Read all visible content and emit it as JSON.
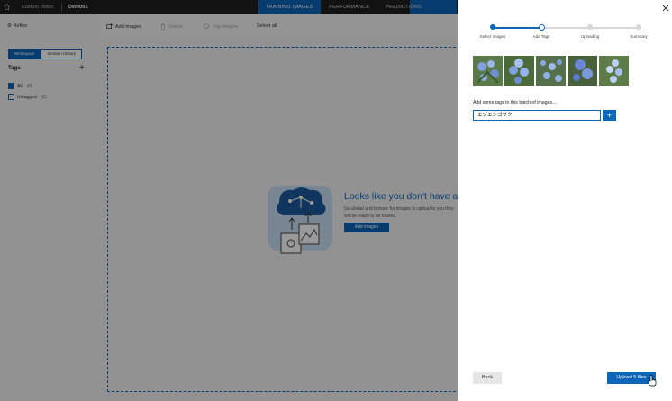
{
  "topbar": {
    "app_name": "Custom Vision",
    "project_name": "Demo01",
    "tabs": [
      {
        "label": "TRAINING IMAGES",
        "active": true
      },
      {
        "label": "PERFORMANCE",
        "active": false
      },
      {
        "label": "PREDICTIONS",
        "active": false
      }
    ]
  },
  "sidebar": {
    "refine_label": "Refine",
    "view_toggle": {
      "workspace": "Workspace",
      "iteration_history": "Iteration History"
    },
    "tags_title": "Tags",
    "tags": [
      {
        "label": "All",
        "count": "(0)",
        "checked": true
      },
      {
        "label": "Untagged",
        "count": "(0)",
        "checked": false
      }
    ]
  },
  "toolbar": {
    "add_images": "Add images",
    "delete": "Delete",
    "tag_images": "Tag images",
    "select_all": "Select all"
  },
  "empty_state": {
    "heading": "Looks like you don't have any",
    "description": "Go ahead and browse for images to upload to you they will be ready to be trained.",
    "button": "Add images"
  },
  "upload_panel": {
    "steps": [
      {
        "label": "Select Images",
        "state": "done"
      },
      {
        "label": "Add Tags",
        "state": "current"
      },
      {
        "label": "Uploading",
        "state": "pending"
      },
      {
        "label": "Summary",
        "state": "pending"
      }
    ],
    "batch_tag_label": "Add some tags to this batch of images...",
    "tag_input_value": "エゾエンゴサク",
    "back_button": "Back",
    "upload_button": "Upload 5 files"
  },
  "colors": {
    "accent": "#0d66b8",
    "topbar": "#1f1f1f"
  }
}
